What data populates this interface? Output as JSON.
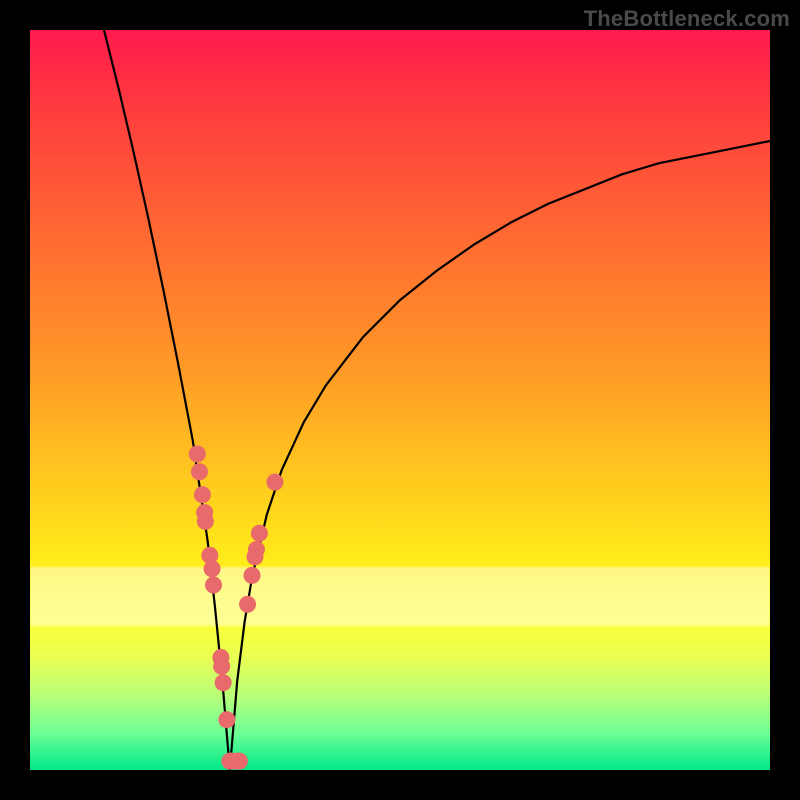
{
  "watermark": "TheBottleneck.com",
  "colors": {
    "dot": "#e86a6a",
    "curve": "#000000",
    "frame_bg_top": "#ff1a4d",
    "frame_bg_bottom": "#00e887",
    "page_bg": "#000000"
  },
  "chart_data": {
    "type": "line",
    "title": "",
    "xlabel": "",
    "ylabel": "",
    "xlim": [
      0,
      100
    ],
    "ylim": [
      0,
      100
    ],
    "grid": false,
    "legend": false,
    "x_min_at": 27,
    "series": [
      {
        "name": "bottleneck-curve",
        "x": [
          10,
          12,
          14,
          16,
          18,
          20,
          22,
          24,
          25,
          26,
          27,
          28,
          29,
          30,
          32,
          34,
          37,
          40,
          45,
          50,
          55,
          60,
          65,
          70,
          75,
          80,
          85,
          90,
          95,
          100
        ],
        "y": [
          100,
          92,
          83.5,
          74.5,
          65,
          55,
          44.5,
          31,
          22,
          12,
          0,
          12,
          20,
          26,
          34.5,
          40.5,
          47,
          52,
          58.5,
          63.5,
          67.5,
          71,
          74,
          76.5,
          78.5,
          80.5,
          82,
          83,
          84,
          85
        ]
      }
    ],
    "points": [
      {
        "x": 22.6,
        "y": 42.7
      },
      {
        "x": 22.9,
        "y": 40.3
      },
      {
        "x": 23.3,
        "y": 37.2
      },
      {
        "x": 23.6,
        "y": 34.8
      },
      {
        "x": 23.7,
        "y": 33.6
      },
      {
        "x": 24.3,
        "y": 29.0
      },
      {
        "x": 24.6,
        "y": 27.2
      },
      {
        "x": 24.8,
        "y": 25.0
      },
      {
        "x": 25.8,
        "y": 15.2
      },
      {
        "x": 25.9,
        "y": 14.0
      },
      {
        "x": 26.1,
        "y": 11.8
      },
      {
        "x": 26.6,
        "y": 6.8
      },
      {
        "x": 27.0,
        "y": 1.2
      },
      {
        "x": 27.2,
        "y": 1.2
      },
      {
        "x": 28.0,
        "y": 1.2
      },
      {
        "x": 28.3,
        "y": 1.2
      },
      {
        "x": 29.4,
        "y": 22.4
      },
      {
        "x": 30.0,
        "y": 26.3
      },
      {
        "x": 30.4,
        "y": 28.8
      },
      {
        "x": 30.6,
        "y": 29.8
      },
      {
        "x": 31.0,
        "y": 32.0
      },
      {
        "x": 33.1,
        "y": 38.9
      }
    ]
  }
}
